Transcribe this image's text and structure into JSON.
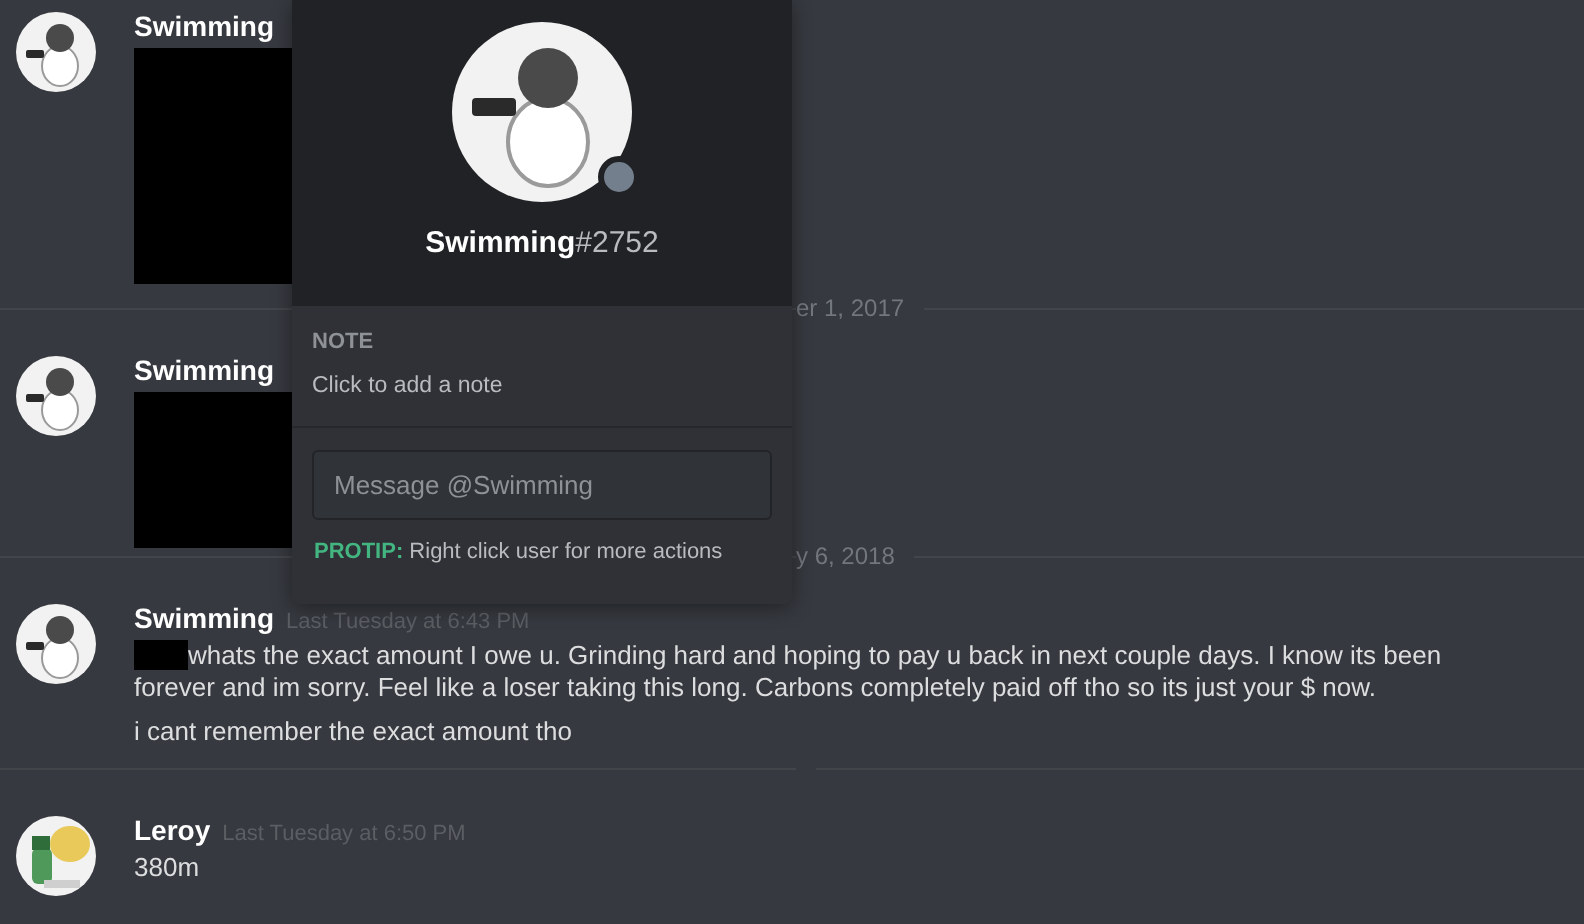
{
  "messages": [
    {
      "author": "Swimming",
      "avatar": {
        "kind": "penguin"
      },
      "attachment": {
        "kind": "redacted"
      },
      "divider": true,
      "divider_text": "er 1, 2017"
    },
    {
      "author": "Swimming",
      "avatar": {
        "kind": "penguin"
      },
      "attachment": {
        "kind": "redacted"
      },
      "divider": true,
      "divider_text": "y 6, 2018"
    },
    {
      "author": "Swimming",
      "avatar": {
        "kind": "penguin"
      },
      "timestamp": "Last Tuesday at 6:43 PM",
      "lines": [
        {
          "text": "whats the exact amount I owe u. Grinding hard and hoping to pay u back in next couple days. I know its been forever and im sorry. Feel like a loser taking this long. Carbons completely paid off tho so its just your $ now.",
          "redacted_prefix": true
        },
        {
          "text": "i cant remember the exact amount tho",
          "redacted_prefix": false
        }
      ],
      "divider": true
    },
    {
      "author": "Leroy",
      "avatar": {
        "kind": "leprechaun"
      },
      "timestamp": "Last Tuesday at 6:50 PM",
      "lines": [
        {
          "text": "380m",
          "redacted_prefix": false
        }
      ],
      "divider": false
    }
  ],
  "profile_popout": {
    "username": "Swimming",
    "discriminator": "#2752",
    "online": false,
    "note_label": "NOTE",
    "note_placeholder": "Click to add a note",
    "message_placeholder": "Message @Swimming",
    "protip_label": "PROTIP:",
    "protip_text": "Right click user for more actions"
  }
}
